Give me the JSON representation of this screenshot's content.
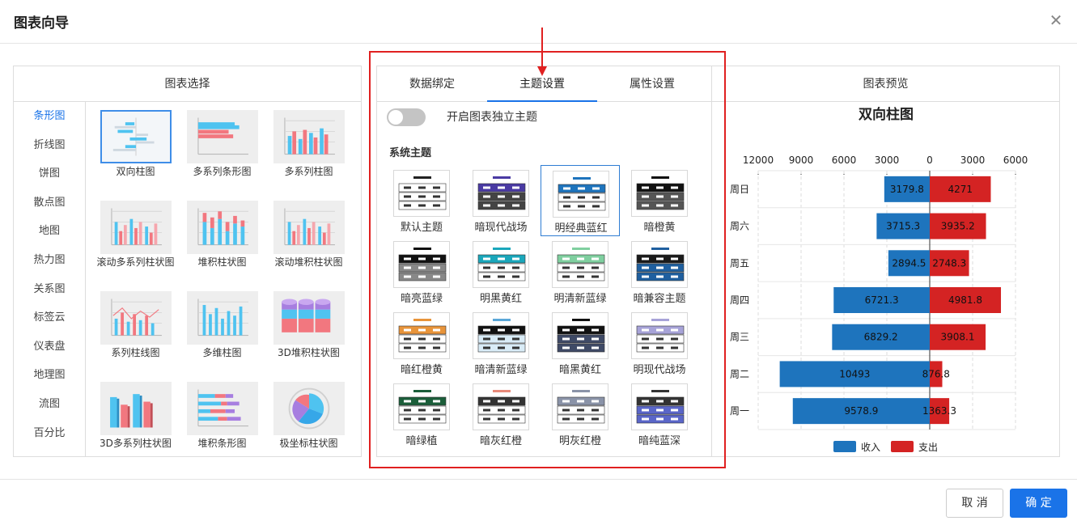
{
  "dialog": {
    "title": "图表向导"
  },
  "left_panel": {
    "title": "图表选择",
    "categories": [
      "条形图",
      "折线图",
      "饼图",
      "散点图",
      "地图",
      "热力图",
      "关系图",
      "标签云",
      "仪表盘",
      "地理图",
      "流图",
      "百分比"
    ],
    "active_category": 0,
    "charts": [
      {
        "label": "双向柱图",
        "icon": "bidirectional-bar-icon"
      },
      {
        "label": "多系列条形图",
        "icon": "multi-series-bar-icon"
      },
      {
        "label": "多系列柱图",
        "icon": "multi-series-column-icon"
      },
      {
        "label": "滚动多系列柱状图",
        "icon": "scroll-multi-column-icon"
      },
      {
        "label": "堆积柱状图",
        "icon": "stacked-column-icon"
      },
      {
        "label": "滚动堆积柱状图",
        "icon": "scroll-stacked-column-icon"
      },
      {
        "label": "系列柱线图",
        "icon": "column-line-icon"
      },
      {
        "label": "多维柱图",
        "icon": "multi-dim-column-icon"
      },
      {
        "label": "3D堆积柱状图",
        "icon": "3d-stacked-column-icon"
      },
      {
        "label": "3D多系列柱状图",
        "icon": "3d-multi-column-icon"
      },
      {
        "label": "堆积条形图",
        "icon": "stacked-bar-icon"
      },
      {
        "label": "极坐标柱状图",
        "icon": "polar-bar-icon"
      }
    ]
  },
  "middle_panel": {
    "tabs": [
      "数据绑定",
      "主题设置",
      "属性设置"
    ],
    "active_tab": 1,
    "toggle_label": "开启图表独立主题",
    "toggle_on": false,
    "section_title": "系统主题",
    "themes": [
      {
        "label": "默认主题",
        "head": "#ffffff",
        "row": "#ffffff",
        "bar": "#222222",
        "dark": false
      },
      {
        "label": "暗现代战场",
        "head": "#4a3aa3",
        "row": "#444444",
        "bar": "#4a3aa3",
        "dark": true
      },
      {
        "label": "明经典蓝红",
        "head": "#1e74bd",
        "row": "#ffffff",
        "bar": "#1e74bd",
        "dark": false
      },
      {
        "label": "暗橙黄",
        "head": "#111111",
        "row": "#555555",
        "bar": "#111111",
        "dark": true
      },
      {
        "label": "暗亮蓝绿",
        "head": "#111111",
        "row": "#888888",
        "bar": "#111111",
        "dark": true
      },
      {
        "label": "明黑黄红",
        "head": "#1aa7bb",
        "row": "#ffffff",
        "bar": "#1aa7bb",
        "dark": false
      },
      {
        "label": "明清新蓝绿",
        "head": "#7fcf9f",
        "row": "#ffffff",
        "bar": "#7fcf9f",
        "dark": false
      },
      {
        "label": "暗兼容主题",
        "head": "#1a1a1a",
        "row": "#1f5f9f",
        "bar": "#1f5f9f",
        "dark": true
      },
      {
        "label": "暗红橙黄",
        "head": "#e8943a",
        "row": "#ffffff",
        "bar": "#e8943a",
        "dark": false
      },
      {
        "label": "暗清新蓝绿",
        "head": "#111111",
        "row": "#d9ecf7",
        "bar": "#5aa7d8",
        "dark": false
      },
      {
        "label": "暗黑黄红",
        "head": "#111111",
        "row": "#3f4a66",
        "bar": "#111111",
        "dark": true
      },
      {
        "label": "明现代战场",
        "head": "#a7a3d8",
        "row": "#ffffff",
        "bar": "#a7a3d8",
        "dark": false
      },
      {
        "label": "暗绿植",
        "head": "#1b5e3a",
        "row": "#ffffff",
        "bar": "#1b5e3a",
        "dark": false
      },
      {
        "label": "暗灰红橙",
        "head": "#333333",
        "row": "#ffffff",
        "bar": "#e88a7a",
        "dark": false
      },
      {
        "label": "明灰红橙",
        "head": "#8a93a8",
        "row": "#ffffff",
        "bar": "#8a93a8",
        "dark": false
      },
      {
        "label": "暗纯蓝深",
        "head": "#333333",
        "row": "#5a66c8",
        "bar": "#333333",
        "dark": true
      }
    ],
    "active_theme": 2
  },
  "right_panel": {
    "title": "图表预览"
  },
  "chart_data": {
    "type": "bar",
    "title": "双向柱图",
    "orientation": "horizontal",
    "categories": [
      "周日",
      "周六",
      "周五",
      "周四",
      "周三",
      "周二",
      "周一"
    ],
    "series": [
      {
        "name": "收入",
        "values": [
          3179.8,
          3715.3,
          2894.5,
          6721.3,
          6829.2,
          10493,
          9578.9
        ],
        "color": "#1e74bd",
        "direction": "left"
      },
      {
        "name": "支出",
        "values": [
          4271,
          3935.2,
          2748.3,
          4981.8,
          3908.1,
          876.8,
          1363.3
        ],
        "color": "#d42323",
        "direction": "right"
      }
    ],
    "value_labels": [
      "3179.8",
      "3715.3",
      "2894.5",
      "6721.3",
      "6829.2",
      "10493",
      "9578.9",
      "4271",
      "3935.2",
      "2748.3",
      "4981.8",
      "3908.1",
      "876.8",
      "1363.3"
    ],
    "x_ticks": [
      12000,
      9000,
      6000,
      3000,
      0,
      3000,
      6000
    ],
    "x_tick_labels": [
      "12000",
      "9000",
      "6000",
      "3000",
      "0",
      "3000",
      "6000"
    ],
    "xlim": [
      -12000,
      6000
    ],
    "grid": true,
    "legend": "bottom"
  },
  "footer": {
    "cancel_label": "取 消",
    "ok_label": "确 定"
  },
  "colors": {
    "accent": "#1a73e8",
    "annotation": "#e02020"
  }
}
